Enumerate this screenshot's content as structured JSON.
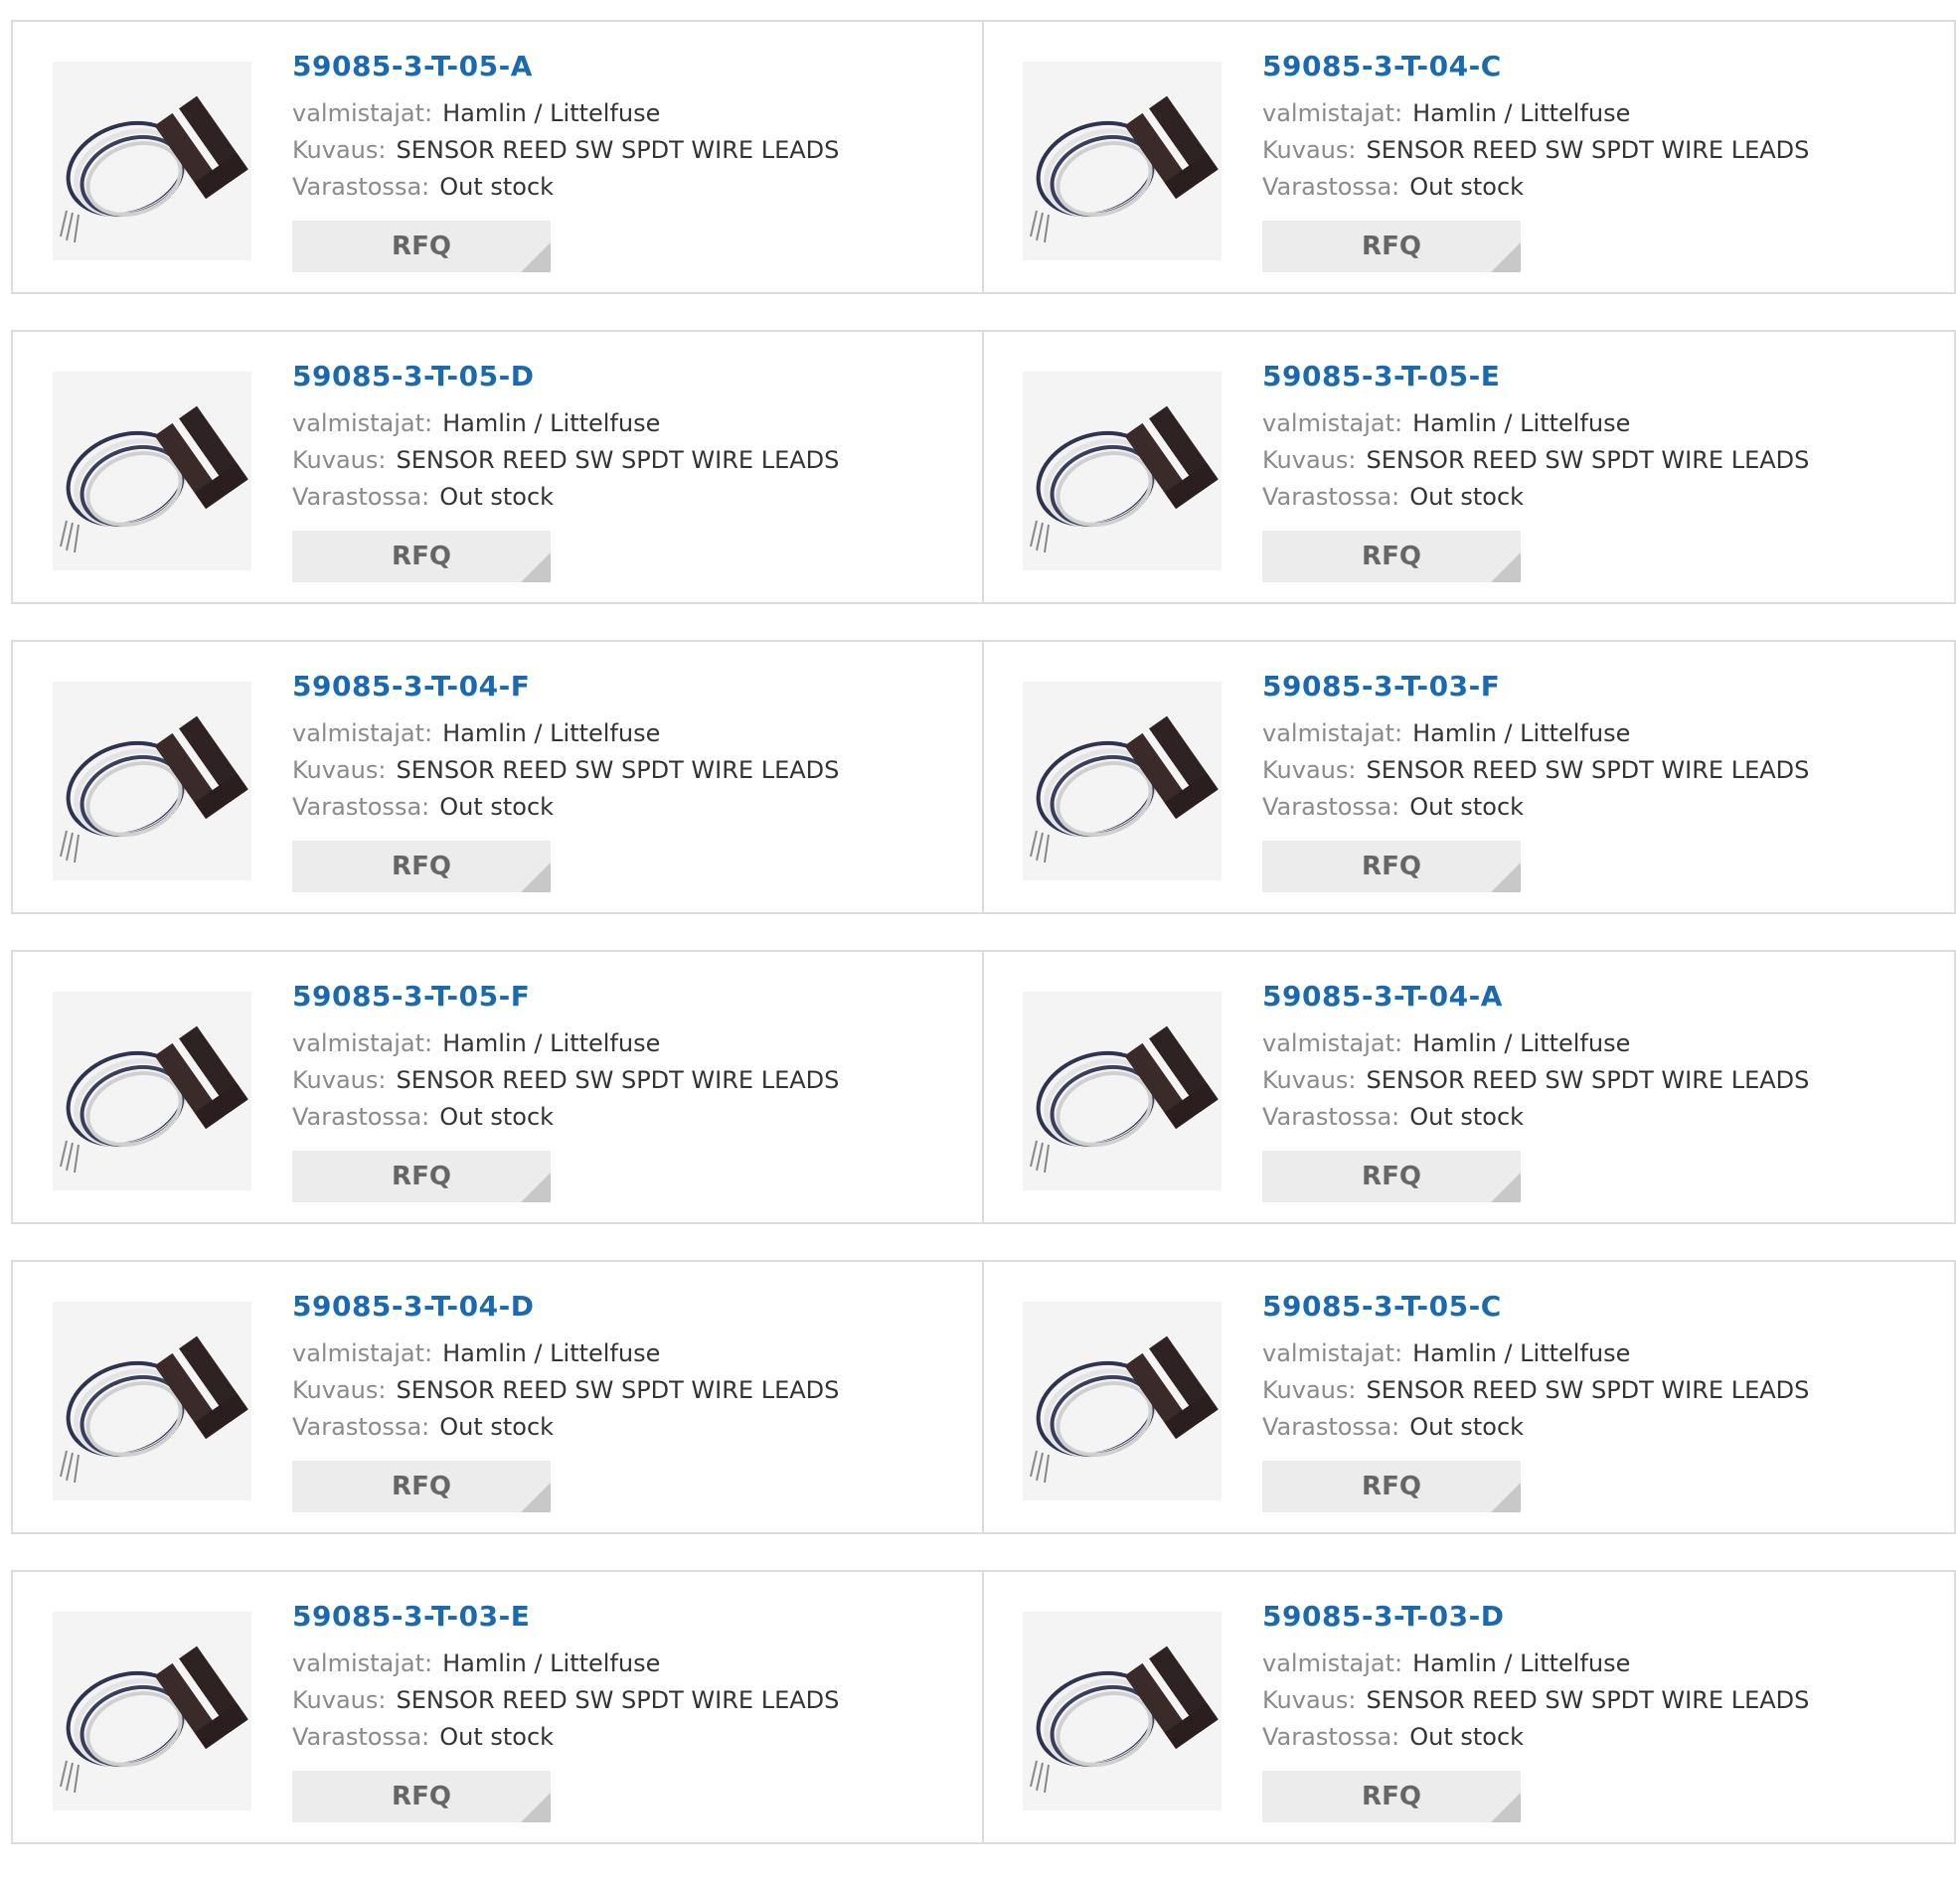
{
  "labels": {
    "manufacturer": "valmistajat:",
    "description": "Kuvaus:",
    "stock": "Varastossa:"
  },
  "rfq_label": "RFQ",
  "products": [
    {
      "part": "59085-3-T-05-A",
      "manufacturer": "Hamlin / Littelfuse",
      "description": "SENSOR REED SW SPDT WIRE LEADS",
      "stock": "Out stock"
    },
    {
      "part": "59085-3-T-04-C",
      "manufacturer": "Hamlin / Littelfuse",
      "description": "SENSOR REED SW SPDT WIRE LEADS",
      "stock": "Out stock"
    },
    {
      "part": "59085-3-T-05-D",
      "manufacturer": "Hamlin / Littelfuse",
      "description": "SENSOR REED SW SPDT WIRE LEADS",
      "stock": "Out stock"
    },
    {
      "part": "59085-3-T-05-E",
      "manufacturer": "Hamlin / Littelfuse",
      "description": "SENSOR REED SW SPDT WIRE LEADS",
      "stock": "Out stock"
    },
    {
      "part": "59085-3-T-04-F",
      "manufacturer": "Hamlin / Littelfuse",
      "description": "SENSOR REED SW SPDT WIRE LEADS",
      "stock": "Out stock"
    },
    {
      "part": "59085-3-T-03-F",
      "manufacturer": "Hamlin / Littelfuse",
      "description": "SENSOR REED SW SPDT WIRE LEADS",
      "stock": "Out stock"
    },
    {
      "part": "59085-3-T-05-F",
      "manufacturer": "Hamlin / Littelfuse",
      "description": "SENSOR REED SW SPDT WIRE LEADS",
      "stock": "Out stock"
    },
    {
      "part": "59085-3-T-04-A",
      "manufacturer": "Hamlin / Littelfuse",
      "description": "SENSOR REED SW SPDT WIRE LEADS",
      "stock": "Out stock"
    },
    {
      "part": "59085-3-T-04-D",
      "manufacturer": "Hamlin / Littelfuse",
      "description": "SENSOR REED SW SPDT WIRE LEADS",
      "stock": "Out stock"
    },
    {
      "part": "59085-3-T-05-C",
      "manufacturer": "Hamlin / Littelfuse",
      "description": "SENSOR REED SW SPDT WIRE LEADS",
      "stock": "Out stock"
    },
    {
      "part": "59085-3-T-03-E",
      "manufacturer": "Hamlin / Littelfuse",
      "description": "SENSOR REED SW SPDT WIRE LEADS",
      "stock": "Out stock"
    },
    {
      "part": "59085-3-T-03-D",
      "manufacturer": "Hamlin / Littelfuse",
      "description": "SENSOR REED SW SPDT WIRE LEADS",
      "stock": "Out stock"
    }
  ],
  "colors": {
    "part_link": "#1b6ab0",
    "label": "#8a8a8a",
    "value": "#333333",
    "rfq_bg": "#ececec",
    "border": "#dcdcdc"
  },
  "icons": {
    "product_image": "reed-sensor-with-wire-leads"
  }
}
